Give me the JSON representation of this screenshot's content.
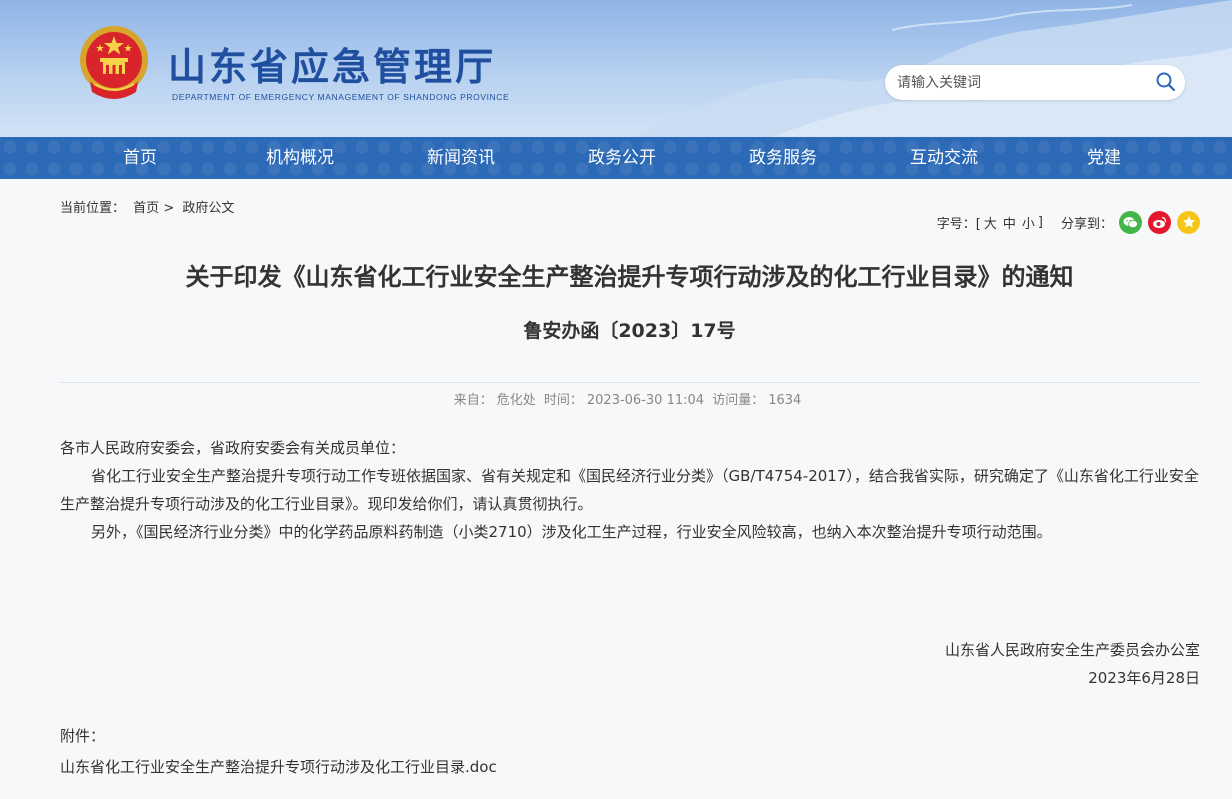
{
  "header": {
    "title": "山东省应急管理厅",
    "subtitle": "DEPARTMENT OF EMERGENCY MANAGEMENT OF SHANDONG PROVINCE",
    "search_placeholder": "请输入关键词"
  },
  "nav": {
    "items": [
      "首页",
      "机构概况",
      "新闻资讯",
      "政务公开",
      "政务服务",
      "互动交流",
      "党建"
    ]
  },
  "breadcrumb": {
    "prefix": "当前位置：",
    "home": "首页",
    "sep": ">",
    "current": "政府公文"
  },
  "tools": {
    "font_label": "字号：[",
    "sizes": [
      "大",
      "中",
      "小"
    ],
    "font_end": "]",
    "share_label": "分享到：",
    "share_icons": [
      "wechat-icon",
      "weibo-icon",
      "favorite-icon"
    ],
    "colors": {
      "wechat": "#44b549",
      "weibo": "#e6162d",
      "favorite": "#f5c518"
    }
  },
  "document": {
    "title": "关于印发《山东省化工行业安全生产整治提升专项行动涉及的化工行业目录》的通知",
    "number": "鲁安办函〔2023〕17号",
    "meta": {
      "source_label": "来自：",
      "source": "危化处",
      "time_label": "时间：",
      "time": "2023-06-30 11:04",
      "views_label": "访问量：",
      "views": "1634"
    },
    "salutation": "各市人民政府安委会，省政府安委会有关成员单位：",
    "paragraphs": [
      "省化工行业安全生产整治提升专项行动工作专班依据国家、省有关规定和《国民经济行业分类》（GB/T4754-2017），结合我省实际，研究确定了《山东省化工行业安全生产整治提升专项行动涉及的化工行业目录》。现印发给你们，请认真贯彻执行。",
      "另外，《国民经济行业分类》中的化学药品原料药制造（小类2710）涉及化工生产过程，行业安全风险较高，也纳入本次整治提升专项行动范围。"
    ],
    "signer": "山东省人民政府安全生产委员会办公室",
    "date": "2023年6月28日",
    "attachment_label": "附件：",
    "attachment": "山东省化工行业安全生产整治提升专项行动涉及化工行业目录.doc"
  }
}
